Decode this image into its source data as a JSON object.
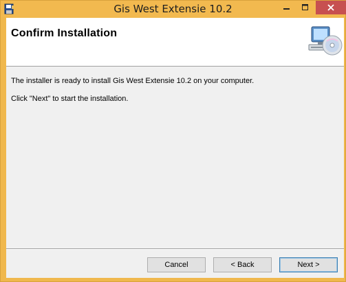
{
  "window": {
    "title": "Gis West Extensie 10.2",
    "icons": {
      "app": "installer-floppy-icon",
      "minimize": "minimize-icon",
      "maximize": "maximize-icon",
      "close": "close-icon"
    },
    "colors": {
      "titlebar": "#f2b94f",
      "close_button": "#c75050"
    }
  },
  "header": {
    "title": "Confirm Installation",
    "icon": "computer-disc-icon"
  },
  "body": {
    "line1": "The installer is ready to install Gis West Extensie 10.2 on your computer.",
    "line2": "Click \"Next\" to start the installation."
  },
  "buttons": {
    "cancel": "Cancel",
    "back": "< Back",
    "next": "Next >"
  }
}
